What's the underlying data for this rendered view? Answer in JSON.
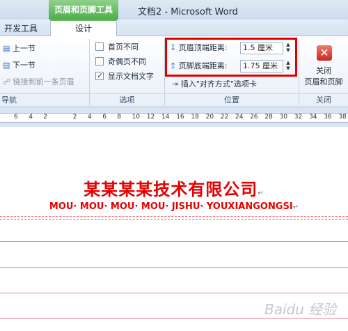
{
  "titlebar": {
    "context_tab": "页眉和页脚工具",
    "doc_title": "文档2 - Microsoft Word"
  },
  "tabs": {
    "developer": "开发工具",
    "design": "设计"
  },
  "ribbon": {
    "navigation": {
      "prev_section": "上一节",
      "next_section": "下一节",
      "link_previous": "链接到前一条页眉",
      "group_label": "导航"
    },
    "options": {
      "different_first_page": "首页不同",
      "different_odd_even": "奇偶页不同",
      "show_document_text": "显示文档文字",
      "group_label": "选项",
      "first_page_checked": false,
      "odd_even_checked": false,
      "show_text_checked": true
    },
    "position": {
      "header_from_top_label": "页眉顶端距离:",
      "header_from_top_value": "1.5 厘米",
      "footer_from_bottom_label": "页脚底端距离:",
      "footer_from_bottom_value": "1.75 厘米",
      "insert_alignment_tab": "插入\"对齐方式\"选项卡",
      "group_label": "位置"
    },
    "close": {
      "line1": "关闭",
      "line2": "页眉和页脚",
      "group_label": "关闭"
    }
  },
  "ruler": {
    "ticks": [
      "6",
      "4",
      "2",
      "",
      "2",
      "4",
      "6",
      "8",
      "10",
      "12",
      "14",
      "16",
      "18",
      "20",
      "22",
      "24",
      "26",
      "28",
      "30",
      "32",
      "34",
      "36",
      "38"
    ]
  },
  "document": {
    "company_name_cn": "某某某某技术有限公司",
    "company_name_pinyin": "MOU· MOU· MOU· MOU· JISHU· YOUXIANGONGSI"
  },
  "watermark": "Baidu 经验",
  "colors": {
    "accent_green": "#4fae4b",
    "highlight_red": "#e00000",
    "header_text_red": "#e60000"
  }
}
